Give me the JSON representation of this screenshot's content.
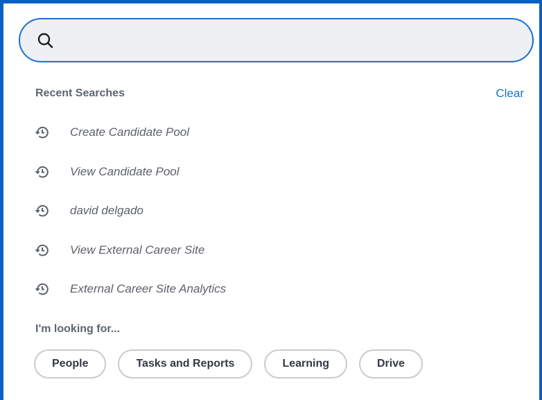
{
  "search": {
    "value": "",
    "placeholder": ""
  },
  "recent": {
    "title": "Recent Searches",
    "clear_label": "Clear",
    "items": [
      {
        "label": "Create Candidate Pool",
        "icon": "history-icon"
      },
      {
        "label": "View Candidate Pool",
        "icon": "history-icon"
      },
      {
        "label": "david delgado",
        "icon": "history-icon"
      },
      {
        "label": "View External Career Site",
        "icon": "history-icon"
      },
      {
        "label": "External Career Site Analytics",
        "icon": "history-icon"
      }
    ]
  },
  "looking_for": {
    "title": "I'm looking for...",
    "chips": [
      "People",
      "Tasks and Reports",
      "Learning",
      "Drive"
    ]
  },
  "colors": {
    "accent_border": "#0a5fc4",
    "link": "#1a73c9",
    "search_bg": "#eef0f3"
  }
}
